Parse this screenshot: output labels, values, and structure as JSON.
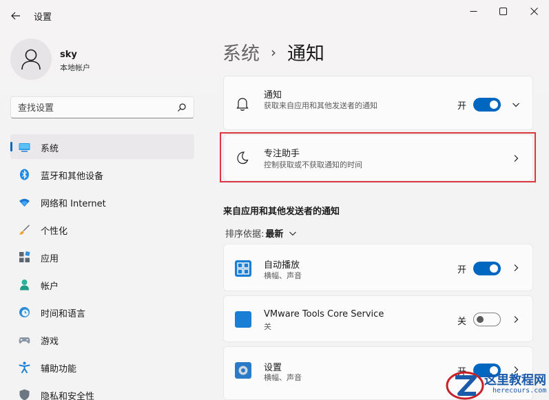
{
  "window": {
    "title": "设置"
  },
  "profile": {
    "name": "sky",
    "account_type": "本地帐户"
  },
  "search": {
    "placeholder": "查找设置"
  },
  "sidebar": {
    "items": [
      {
        "label": "系统",
        "icon": "monitor-icon",
        "active": true
      },
      {
        "label": "蓝牙和其他设备",
        "icon": "bluetooth-icon"
      },
      {
        "label": "网络和 Internet",
        "icon": "wifi-icon"
      },
      {
        "label": "个性化",
        "icon": "brush-icon"
      },
      {
        "label": "应用",
        "icon": "apps-icon"
      },
      {
        "label": "帐户",
        "icon": "person-icon"
      },
      {
        "label": "时间和语言",
        "icon": "globe-clock-icon"
      },
      {
        "label": "游戏",
        "icon": "gamepad-icon"
      },
      {
        "label": "辅助功能",
        "icon": "accessibility-icon"
      },
      {
        "label": "隐私和安全性",
        "icon": "shield-icon"
      }
    ]
  },
  "breadcrumb": {
    "parent": "系统",
    "separator": "›",
    "current": "通知"
  },
  "notifications_card": {
    "title": "通知",
    "description": "获取来自应用和其他发送者的通知",
    "toggle_label": "开",
    "toggle_state": "on"
  },
  "focus_card": {
    "title": "专注助手",
    "description": "控制获取或不获取通知的时间"
  },
  "apps_section": {
    "title": "来自应用和其他发送者的通知",
    "sort_label": "排序依据:",
    "sort_value": "最新"
  },
  "apps": [
    {
      "name": "自动播放",
      "detail": "横幅、声音",
      "toggle_label": "开",
      "toggle_state": "on",
      "icon": "autoplay-icon"
    },
    {
      "name": "VMware Tools Core Service",
      "detail": "关",
      "toggle_label": "关",
      "toggle_state": "off",
      "icon": "vmware-icon"
    },
    {
      "name": "设置",
      "detail": "横幅、声音",
      "toggle_label": "开",
      "toggle_state": "on",
      "icon": "settings-gear-icon"
    }
  ],
  "watermark": {
    "title": "这里教程网",
    "url": "herecours.com"
  },
  "colors": {
    "accent": "#0067c0",
    "highlight_border": "#d9363e",
    "background": "#f3f3f3",
    "card": "#fbfbfb"
  }
}
